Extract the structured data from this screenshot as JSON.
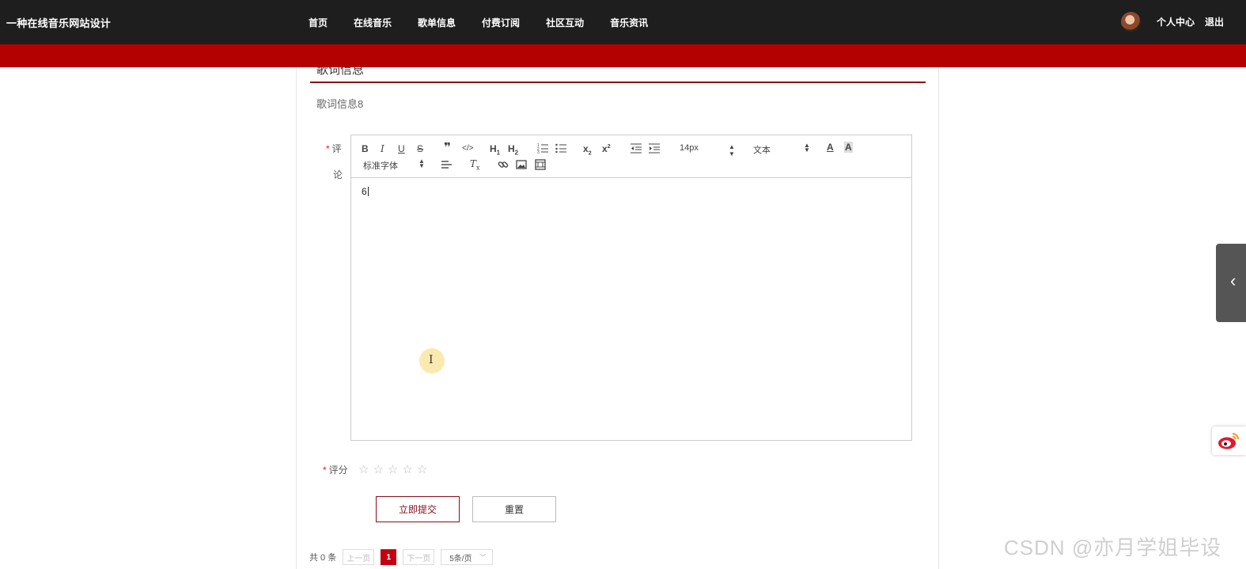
{
  "header": {
    "site_title": "一种在线音乐网站设计",
    "nav": [
      "首页",
      "在线音乐",
      "歌单信息",
      "付费订阅",
      "社区互动",
      "音乐资讯"
    ],
    "user_center": "个人中心",
    "logout": "退出"
  },
  "section": {
    "title": "歌词信息",
    "lyrics_text": "歌词信息8"
  },
  "form": {
    "required_mark": "*",
    "comment_label_line1": "评",
    "comment_label_line2": "论",
    "rating_label": "评分",
    "editor_content": "6",
    "rating_value": 0,
    "rating_max": 5,
    "submit_label": "立即提交",
    "reset_label": "重置"
  },
  "editor_toolbar": {
    "font_size": "14px",
    "header_select": "文本",
    "font_family": "标准字体",
    "icons": [
      "bold-icon",
      "italic-icon",
      "underline-icon",
      "strike-icon",
      "blockquote-icon",
      "code-block-icon",
      "header1-icon",
      "header2-icon",
      "ordered-list-icon",
      "bullet-list-icon",
      "subscript-icon",
      "superscript-icon",
      "outdent-icon",
      "indent-icon",
      "font-color-icon",
      "background-color-icon",
      "align-icon",
      "clean-format-icon",
      "link-icon",
      "image-icon",
      "video-icon"
    ]
  },
  "pager": {
    "total_text": "共 0 条",
    "prev": "上一页",
    "current": "1",
    "next": "下一页",
    "page_size": "5条/页"
  },
  "watermark": "CSDN @亦月学姐毕设",
  "colors": {
    "header_bg": "#1e1e1f",
    "red_band": "#b30000",
    "accent": "#8a0e18",
    "current_page": "#c40010"
  }
}
